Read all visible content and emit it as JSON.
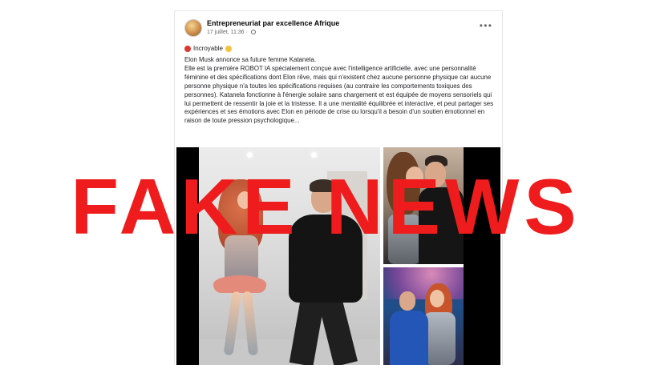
{
  "post": {
    "page_name": "Entrepreneuriat par excellence Afrique",
    "timestamp": "17 juillet, 11:36 ·",
    "reaction_line": "Incroyable",
    "text": [
      "Elon Musk annonce sa future femme Katanela.",
      " Elle est la première ROBOT IA spécialement conçue avec l'intelligence artificielle, avec une personnalité féminine et des spécifications dont Elon rêve, mais qui n'existent chez aucune personne physique car aucune personne physique n'a toutes les spécifications requises (au contraire les comportements toxiques des personnes). Katanela fonctionne à l'énergie solaire sans chargement et est équipée de moyens sensoriels qui lui permettent de ressentir la joie et la tristesse. Il a une mentalité équilibrée et interactive, et peut partager ses expériences et ses émotions avec Elon en période de crise ou lorsqu'il a besoin d'un soutien émotionnel en raison de toute pression psychologique..."
    ]
  },
  "stamp": {
    "text": "FAKE NEWS",
    "color": "#ee1c1c"
  },
  "icons": [
    "globe-icon",
    "more-options-icon",
    "red-heart-emoji",
    "shocked-face-emoji"
  ]
}
